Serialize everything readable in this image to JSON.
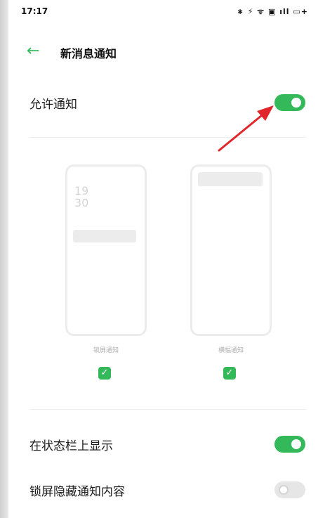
{
  "status_bar": {
    "time": "17:17",
    "icons_text": "∗ ⚡ ᯤ ▣ ıll ▭+",
    "icon_names": [
      "bluetooth-icon",
      "nfc-icon",
      "wifi-icon",
      "sim-icon",
      "signal-icon",
      "battery-icon"
    ]
  },
  "header": {
    "title": "新消息通知",
    "back_icon": "arrow-left-icon"
  },
  "allow_notifications": {
    "label": "允许通知",
    "enabled": true
  },
  "previews": [
    {
      "caption": "锁屏通知",
      "clock": "19\n30",
      "checked": true
    },
    {
      "caption": "横幅通知",
      "checked": true
    }
  ],
  "settings": [
    {
      "label": "在状态栏上显示",
      "enabled": true
    },
    {
      "label": "锁屏隐藏通知内容",
      "enabled": false
    }
  ],
  "colors": {
    "accent": "#33b85a",
    "arrow": "#e0262b",
    "text": "#1a1a1a"
  }
}
